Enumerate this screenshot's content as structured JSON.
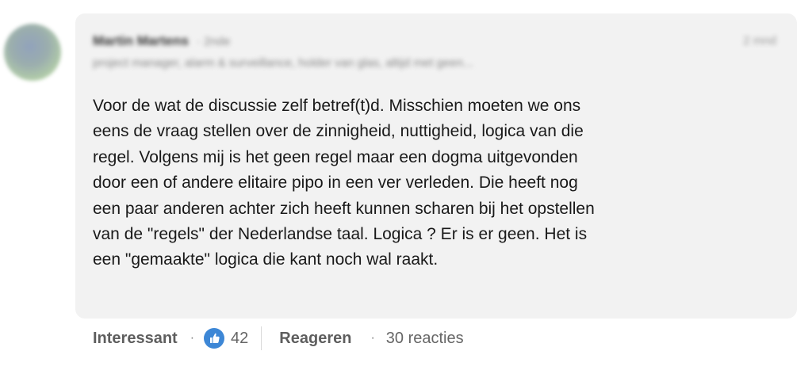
{
  "comment": {
    "author": {
      "name": "Martin Martens",
      "degree": "· 2nde",
      "headline": "project manager, alarm & surveillance, holder van glas, altijd met geen...",
      "timestamp": "2 mnd"
    },
    "body": "Voor de wat de discussie zelf betref(t)d. Misschien moeten we ons\neens de vraag stellen over de zinnigheid, nuttigheid, logica van die\nregel. Volgens mij is het geen regel maar een dogma uitgevonden\ndoor een of andere elitaire pipo in een ver verleden. Die heeft nog\neen paar anderen achter zich heeft kunnen scharen bij het opstellen\nvan de \"regels\" der Nederlandse taal. Logica ? Er is er geen. Het is\neen \"gemaakte\" logica die kant noch wal raakt."
  },
  "actions": {
    "reaction_label": "Interessant",
    "separator": "·",
    "reaction_icon": "like-icon",
    "reaction_count": "42",
    "reply_label": "Reageren",
    "replies_count": "30 reacties"
  },
  "colors": {
    "bubble_bg": "#f2f2f2",
    "text": "#191919",
    "muted": "#666666",
    "like_blue": "#3d87d6"
  }
}
